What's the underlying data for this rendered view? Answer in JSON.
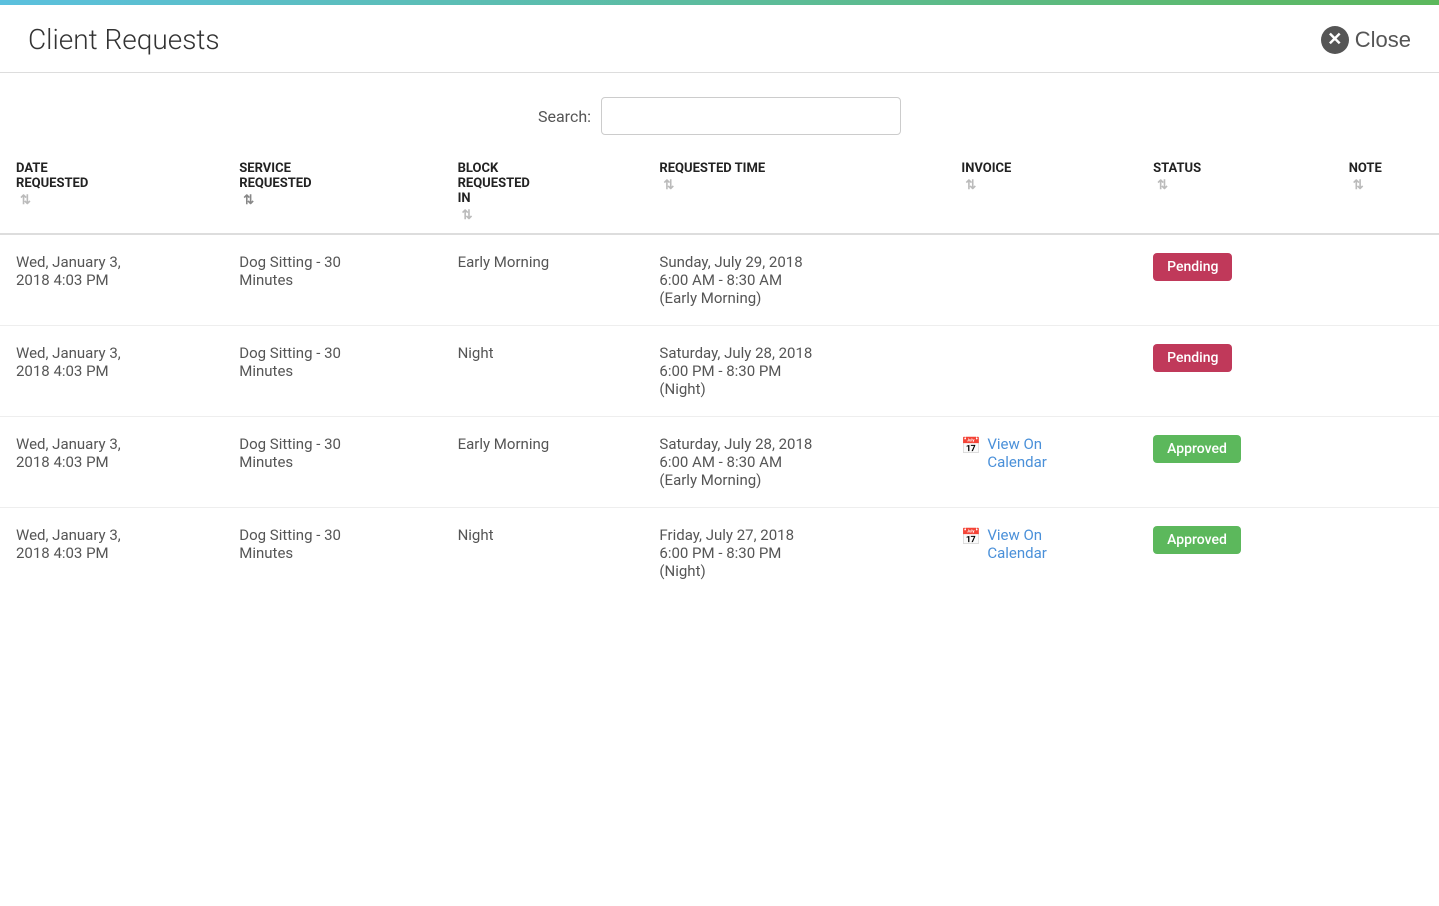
{
  "top_bar": {},
  "header": {
    "title": "Client Requests",
    "close_label": "Close"
  },
  "search": {
    "label": "Search:",
    "placeholder": "",
    "value": ""
  },
  "table": {
    "columns": [
      {
        "id": "date_requested",
        "label": "DATE\nREQUESTED",
        "multi": true
      },
      {
        "id": "service_requested",
        "label": "SERVICE\nREQUESTED",
        "multi": true
      },
      {
        "id": "block_requested",
        "label": "BLOCK\nREQUESTED\nIN",
        "multi": true
      },
      {
        "id": "requested_time",
        "label": "REQUESTED TIME",
        "multi": false
      },
      {
        "id": "invoice",
        "label": "INVOICE",
        "multi": false
      },
      {
        "id": "status",
        "label": "STATUS",
        "multi": false
      },
      {
        "id": "note",
        "label": "NOTE",
        "multi": false
      }
    ],
    "rows": [
      {
        "date_requested": "Wed, January 3,\n2018 4:03 PM",
        "service_requested": "Dog Sitting - 30\nMinutes",
        "block_requested": "Early Morning",
        "requested_time": "Sunday, July 29, 2018\n6:00 AM - 8:30 AM\n(Early Morning)",
        "invoice": null,
        "invoice_label": null,
        "status": "Pending",
        "status_type": "pending",
        "note": ""
      },
      {
        "date_requested": "Wed, January 3,\n2018 4:03 PM",
        "service_requested": "Dog Sitting - 30\nMinutes",
        "block_requested": "Night",
        "requested_time": "Saturday, July 28, 2018\n6:00 PM - 8:30 PM\n(Night)",
        "invoice": null,
        "invoice_label": null,
        "status": "Pending",
        "status_type": "pending",
        "note": ""
      },
      {
        "date_requested": "Wed, January 3,\n2018 4:03 PM",
        "service_requested": "Dog Sitting - 30\nMinutes",
        "block_requested": "Early Morning",
        "requested_time": "Saturday, July 28, 2018\n6:00 AM - 8:30 AM\n(Early Morning)",
        "invoice": "view_on_calendar",
        "invoice_label": "View On\nCalendar",
        "status": "Approved",
        "status_type": "approved",
        "note": ""
      },
      {
        "date_requested": "Wed, January 3,\n2018 4:03 PM",
        "service_requested": "Dog Sitting - 30\nMinutes",
        "block_requested": "Night",
        "requested_time": "Friday, July 27, 2018\n6:00 PM - 8:30 PM\n(Night)",
        "invoice": "view_on_calendar",
        "invoice_label": "View On\nCalendar",
        "status": "Approved",
        "status_type": "approved",
        "note": ""
      }
    ]
  }
}
